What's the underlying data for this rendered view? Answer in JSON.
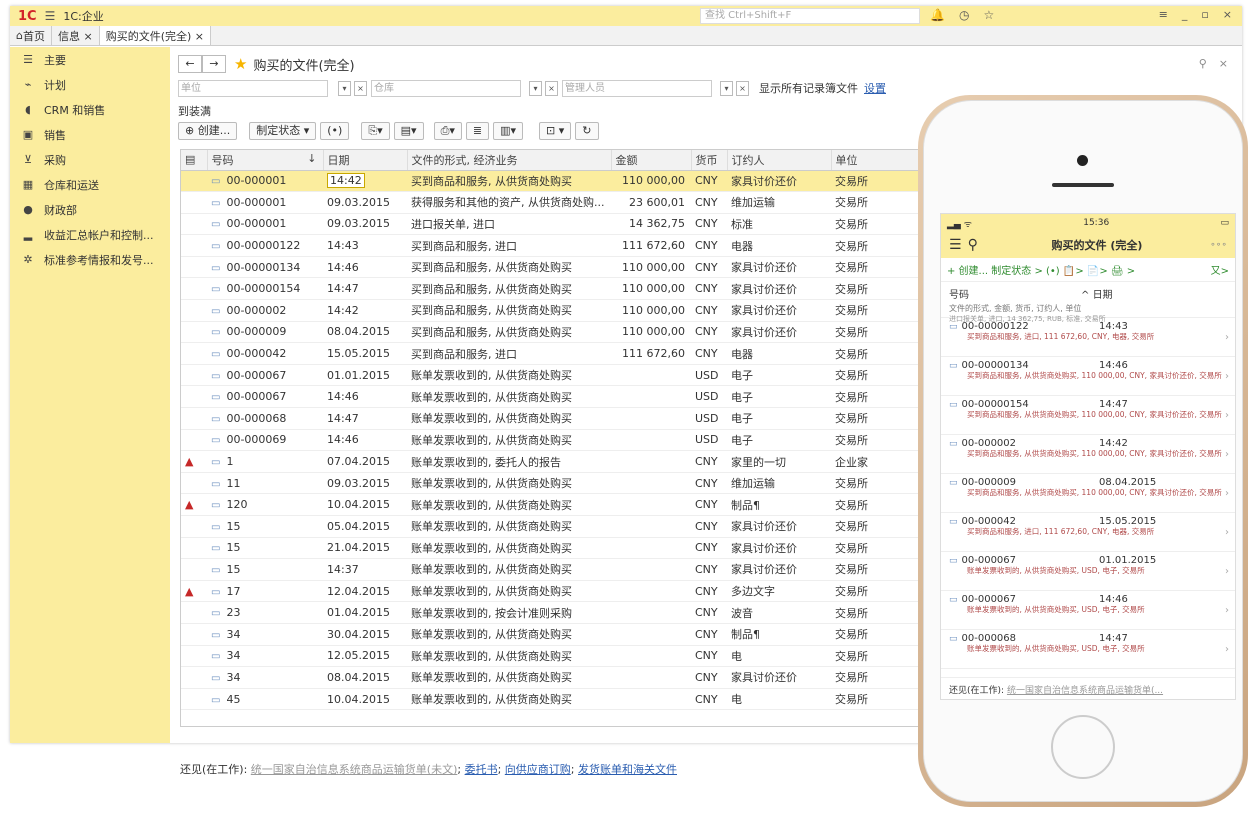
{
  "app": {
    "logo": "1C",
    "title": "1C:企业",
    "search_placeholder": "查找 Ctrl+Shift+F"
  },
  "tabs": [
    {
      "label": "首页"
    },
    {
      "label": "信息 ×"
    },
    {
      "label": "购买的文件(完全) ×"
    }
  ],
  "sidebar": {
    "items": [
      {
        "label": "主要",
        "icon": "menu-icon"
      },
      {
        "label": "计划",
        "icon": "plan-icon"
      },
      {
        "label": "CRM 和销售",
        "icon": "crm-icon"
      },
      {
        "label": "销售",
        "icon": "bag-icon"
      },
      {
        "label": "采购",
        "icon": "cart-icon"
      },
      {
        "label": "仓库和运送",
        "icon": "warehouse-icon"
      },
      {
        "label": "财政部",
        "icon": "finance-icon"
      },
      {
        "label": "收益汇总帐户和控制...",
        "icon": "chart-icon"
      },
      {
        "label": "标准参考情报和发号...",
        "icon": "gear-icon"
      }
    ]
  },
  "form": {
    "title": "购买的文件(完全)",
    "filters": {
      "unit": "单位",
      "warehouse": "仓库",
      "manager": "管理人员"
    },
    "show_all": "显示所有记录簿文件",
    "settings": "设置",
    "arrived": "到装满",
    "toolbar": {
      "create": "创建...",
      "status": "制定状态"
    }
  },
  "table": {
    "columns": [
      "号码",
      "日期",
      "文件的形式, 经济业务",
      "金额",
      "货币",
      "订约人",
      "单位"
    ],
    "rows": [
      {
        "warn": "",
        "num": "00-000001",
        "date": "14:42",
        "doc": "买到商品和服务, 从供货商处购买",
        "sum": "110 000,00",
        "cur": "CNY",
        "party": "家具讨价还价",
        "unit": "交易所"
      },
      {
        "warn": "",
        "num": "00-000001",
        "date": "09.03.2015",
        "doc": "获得服务和其他的资产, 从供货商处购...",
        "sum": "23 600,01",
        "cur": "CNY",
        "party": "维加运输",
        "unit": "交易所"
      },
      {
        "warn": "",
        "num": "00-000001",
        "date": "09.03.2015",
        "doc": "进口报关单, 进口",
        "sum": "14 362,75",
        "cur": "CNY",
        "party": "标准",
        "unit": "交易所"
      },
      {
        "warn": "",
        "num": "00-00000122",
        "date": "14:43",
        "doc": "买到商品和服务, 进口",
        "sum": "111 672,60",
        "cur": "CNY",
        "party": "电器",
        "unit": "交易所"
      },
      {
        "warn": "",
        "num": "00-00000134",
        "date": "14:46",
        "doc": "买到商品和服务, 从供货商处购买",
        "sum": "110 000,00",
        "cur": "CNY",
        "party": "家具讨价还价",
        "unit": "交易所"
      },
      {
        "warn": "",
        "num": "00-00000154",
        "date": "14:47",
        "doc": "买到商品和服务, 从供货商处购买",
        "sum": "110 000,00",
        "cur": "CNY",
        "party": "家具讨价还价",
        "unit": "交易所"
      },
      {
        "warn": "",
        "num": "00-000002",
        "date": "14:42",
        "doc": "买到商品和服务, 从供货商处购买",
        "sum": "110 000,00",
        "cur": "CNY",
        "party": "家具讨价还价",
        "unit": "交易所"
      },
      {
        "warn": "",
        "num": "00-000009",
        "date": "08.04.2015",
        "doc": "买到商品和服务, 从供货商处购买",
        "sum": "110 000,00",
        "cur": "CNY",
        "party": "家具讨价还价",
        "unit": "交易所"
      },
      {
        "warn": "",
        "num": "00-000042",
        "date": "15.05.2015",
        "doc": "买到商品和服务, 进口",
        "sum": "111 672,60",
        "cur": "CNY",
        "party": "电器",
        "unit": "交易所"
      },
      {
        "warn": "",
        "num": "00-000067",
        "date": "01.01.2015",
        "doc": "账单发票收到的, 从供货商处购买",
        "sum": "",
        "cur": "USD",
        "party": "电子",
        "unit": "交易所"
      },
      {
        "warn": "",
        "num": "00-000067",
        "date": "14:46",
        "doc": "账单发票收到的, 从供货商处购买",
        "sum": "",
        "cur": "USD",
        "party": "电子",
        "unit": "交易所"
      },
      {
        "warn": "",
        "num": "00-000068",
        "date": "14:47",
        "doc": "账单发票收到的, 从供货商处购买",
        "sum": "",
        "cur": "USD",
        "party": "电子",
        "unit": "交易所"
      },
      {
        "warn": "",
        "num": "00-000069",
        "date": "14:46",
        "doc": "账单发票收到的, 从供货商处购买",
        "sum": "",
        "cur": "USD",
        "party": "电子",
        "unit": "交易所"
      },
      {
        "warn": "▲",
        "num": "1",
        "date": "07.04.2015",
        "doc": "账单发票收到的, 委托人的报告",
        "sum": "",
        "cur": "CNY",
        "party": "家里的一切",
        "unit": "企业家"
      },
      {
        "warn": "",
        "num": "11",
        "date": "09.03.2015",
        "doc": "账单发票收到的, 从供货商处购买",
        "sum": "",
        "cur": "CNY",
        "party": "维加运输",
        "unit": "交易所"
      },
      {
        "warn": "▲",
        "num": "120",
        "date": "10.04.2015",
        "doc": "账单发票收到的, 从供货商处购买",
        "sum": "",
        "cur": "CNY",
        "party": "制品¶",
        "unit": "交易所"
      },
      {
        "warn": "",
        "num": "15",
        "date": "05.04.2015",
        "doc": "账单发票收到的, 从供货商处购买",
        "sum": "",
        "cur": "CNY",
        "party": "家具讨价还价",
        "unit": "交易所"
      },
      {
        "warn": "",
        "num": "15",
        "date": "21.04.2015",
        "doc": "账单发票收到的, 从供货商处购买",
        "sum": "",
        "cur": "CNY",
        "party": "家具讨价还价",
        "unit": "交易所"
      },
      {
        "warn": "",
        "num": "15",
        "date": "14:37",
        "doc": "账单发票收到的, 从供货商处购买",
        "sum": "",
        "cur": "CNY",
        "party": "家具讨价还价",
        "unit": "交易所"
      },
      {
        "warn": "▲",
        "num": "17",
        "date": "12.04.2015",
        "doc": "账单发票收到的, 从供货商处购买",
        "sum": "",
        "cur": "CNY",
        "party": "多边文字",
        "unit": "交易所"
      },
      {
        "warn": "",
        "num": "23",
        "date": "01.04.2015",
        "doc": "账单发票收到的, 按会计准则采购",
        "sum": "",
        "cur": "CNY",
        "party": "波音",
        "unit": "交易所"
      },
      {
        "warn": "",
        "num": "34",
        "date": "30.04.2015",
        "doc": "账单发票收到的, 从供货商处购买",
        "sum": "",
        "cur": "CNY",
        "party": "制品¶",
        "unit": "交易所"
      },
      {
        "warn": "",
        "num": "34",
        "date": "12.05.2015",
        "doc": "账单发票收到的, 从供货商处购买",
        "sum": "",
        "cur": "CNY",
        "party": "电",
        "unit": "交易所"
      },
      {
        "warn": "",
        "num": "34",
        "date": "08.04.2015",
        "doc": "账单发票收到的, 从供货商处购买",
        "sum": "",
        "cur": "CNY",
        "party": "家具讨价还价",
        "unit": "交易所"
      },
      {
        "warn": "",
        "num": "45",
        "date": "10.04.2015",
        "doc": "账单发票收到的, 从供货商处购买",
        "sum": "",
        "cur": "CNY",
        "party": "电",
        "unit": "交易所"
      }
    ]
  },
  "footer": {
    "prefix": "还见(在工作):",
    "grey_link": "统一国家自治信息系统商品运输货单(未文)",
    "links": [
      "委托书",
      "向供应商订购",
      "发货账单和海关文件"
    ]
  },
  "phone": {
    "time": "15:36",
    "title": "购买的文件 (完全)",
    "toolbar": "+ 创建... 制定状态 > (•) 📋> 📄> 🖨 >",
    "toolbar_right": "又>",
    "col_num": "号码",
    "col_date": "日期",
    "col_sub": "文件的形式, 金额, 货币, 订约人, 单位",
    "col_partial": "进口报关单, 进口, 14 362,75, RUB, 标准, 交易所",
    "rows": [
      {
        "num": "00-00000122",
        "date": "14:43",
        "desc": "买到商品和服务, 进口, 111 672,60, CNY, 电器, 交易所"
      },
      {
        "num": "00-00000134",
        "date": "14:46",
        "desc": "买到商品和服务, 从供货商处购买, 110 000,00, CNY, 家具讨价还价, 交易所"
      },
      {
        "num": "00-00000154",
        "date": "14:47",
        "desc": "买到商品和服务, 从供货商处购买, 110 000,00, CNY, 家具讨价还价, 交易所"
      },
      {
        "num": "00-000002",
        "date": "14:42",
        "desc": "买到商品和服务, 从供货商处购买, 110 000,00, CNY, 家具讨价还价, 交易所"
      },
      {
        "num": "00-000009",
        "date": "08.04.2015",
        "desc": "买到商品和服务, 从供货商处购买, 110 000,00, CNY, 家具讨价还价, 交易所"
      },
      {
        "num": "00-000042",
        "date": "15.05.2015",
        "desc": "买到商品和服务, 进口, 111 672,60, CNY, 电器, 交易所"
      },
      {
        "num": "00-000067",
        "date": "01.01.2015",
        "desc": "账单发票收到的, 从供货商处购买, USD, 电子, 交易所"
      },
      {
        "num": "00-000067",
        "date": "14:46",
        "desc": "账单发票收到的, 从供货商处购买, USD, 电子, 交易所"
      },
      {
        "num": "00-000068",
        "date": "14:47",
        "desc": "账单发票收到的, 从供货商处购买, USD, 电子, 交易所"
      }
    ],
    "footer_prefix": "还见(在工作):",
    "footer_link": "统一国家自治信息系统商品运输货单(..."
  }
}
